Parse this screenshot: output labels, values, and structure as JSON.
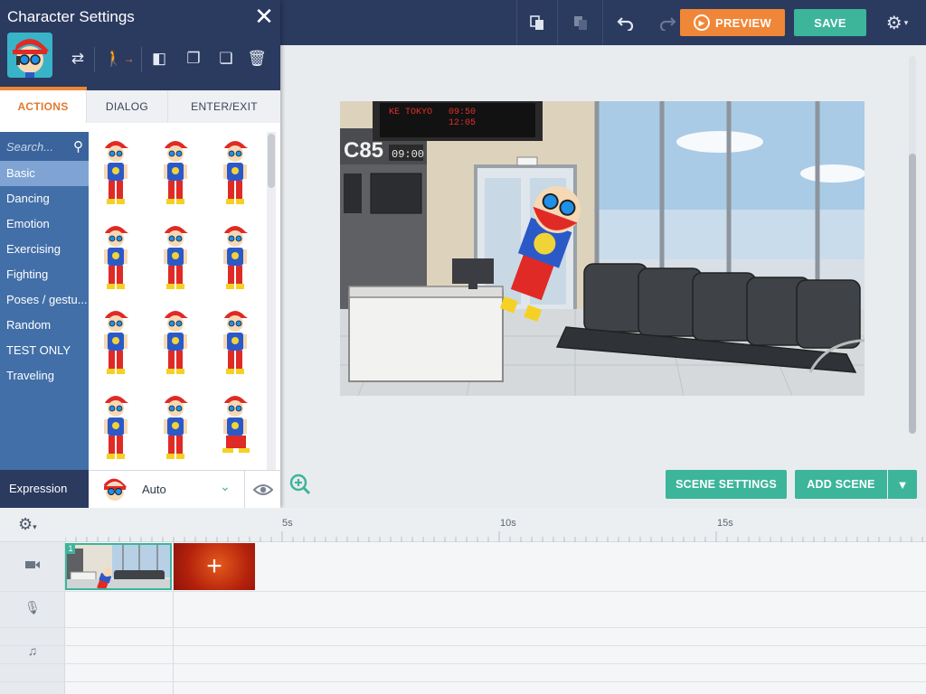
{
  "toolbar": {
    "preview_label": "PREVIEW",
    "save_label": "SAVE",
    "icons": [
      "copy-icon",
      "paste-icon",
      "undo-icon",
      "redo-icon",
      "gear-icon"
    ]
  },
  "panel": {
    "title": "Character Settings",
    "close_label": "✕",
    "tabs": [
      "ACTIONS",
      "DIALOG",
      "ENTER/EXIT"
    ],
    "search_placeholder": "Search...",
    "categories": [
      "Basic",
      "Dancing",
      "Emotion",
      "Exercising",
      "Fighting",
      "Poses / gestu...",
      "Random",
      "TEST ONLY",
      "Traveling"
    ],
    "selected_category": "Basic",
    "expression_label": "Expression",
    "expression_value": "Auto"
  },
  "scene": {
    "gate_sign": "C85",
    "clock": "09:00",
    "board_lines": [
      "09:50",
      "12:05"
    ]
  },
  "stage": {
    "scene_settings_label": "SCENE SETTINGS",
    "add_scene_label": "ADD SCENE"
  },
  "timeline": {
    "ticks": [
      "5s",
      "10s",
      "15s"
    ],
    "clip_number": "1",
    "add_clip_label": "+"
  },
  "colors": {
    "navy": "#2b3a5f",
    "teal": "#3cb59b",
    "orange": "#f08637",
    "category_blue": "#426fa8"
  }
}
